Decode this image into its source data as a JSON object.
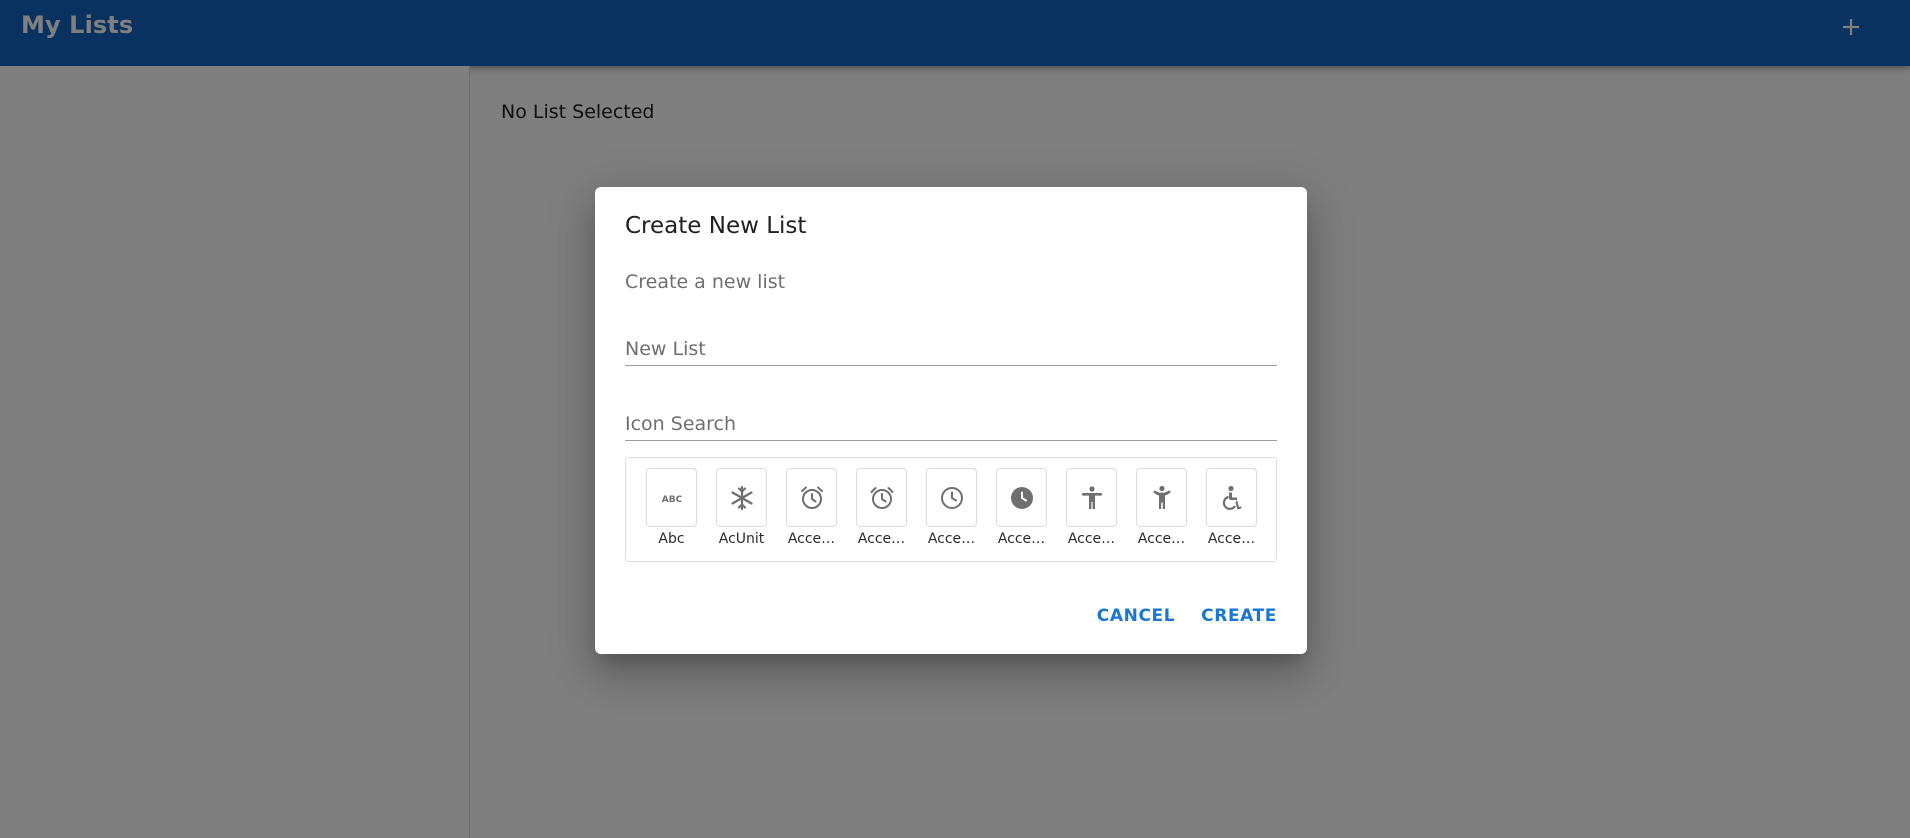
{
  "appbar": {
    "title": "My Lists",
    "add_icon": "plus-icon"
  },
  "main": {
    "empty_text": "No List Selected"
  },
  "dialog": {
    "title": "Create New List",
    "text": "Create a new list",
    "name_placeholder": "New List",
    "name_value": "",
    "search_placeholder": "Icon Search",
    "search_value": "",
    "icons": [
      {
        "label": "Abc",
        "icon": "abc-icon"
      },
      {
        "label": "AcUnit",
        "icon": "ac-unit-icon"
      },
      {
        "label": "Acce…",
        "icon": "access-alarm-icon"
      },
      {
        "label": "Acce…",
        "icon": "access-alarms-icon"
      },
      {
        "label": "Acce…",
        "icon": "access-time-icon"
      },
      {
        "label": "Acce…",
        "icon": "access-time-filled-icon"
      },
      {
        "label": "Acce…",
        "icon": "accessibility-icon"
      },
      {
        "label": "Acce…",
        "icon": "accessibility-new-icon"
      },
      {
        "label": "Acce…",
        "icon": "accessible-icon"
      }
    ],
    "cancel_label": "CANCEL",
    "create_label": "CREATE"
  },
  "colors": {
    "appbar": "#1565c0",
    "accent": "#1976d2",
    "icon": "#6f6f6f"
  }
}
